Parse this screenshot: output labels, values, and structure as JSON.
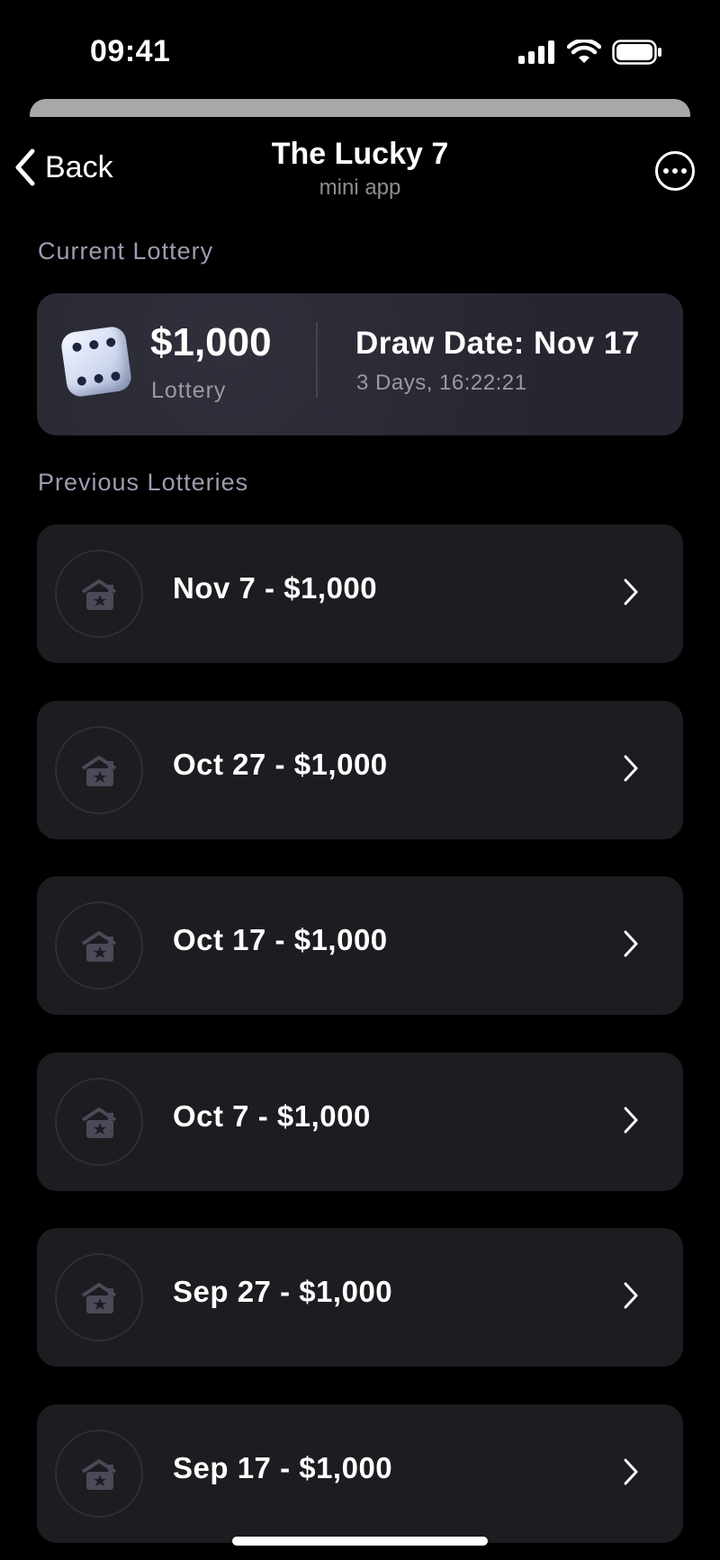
{
  "status_bar": {
    "time": "09:41"
  },
  "nav": {
    "back_label": "Back",
    "title": "The Lucky 7",
    "subtitle": "mini app"
  },
  "current": {
    "section_label": "Current Lottery",
    "amount": "$1,000",
    "amount_label": "Lottery",
    "draw_date": "Draw Date: Nov 17",
    "countdown": "3 Days, 16:22:21"
  },
  "previous": {
    "section_label": "Previous Lotteries",
    "items": [
      {
        "label": "Nov 7 - $1,000",
        "icon": "ticket-star-icon"
      },
      {
        "label": "Oct 27 - $1,000",
        "icon": "ticket-star-icon"
      },
      {
        "label": "Oct 17 - $1,000",
        "icon": "ticket-star-icon"
      },
      {
        "label": "Oct 7 - $1,000",
        "icon": "ticket-star-icon"
      },
      {
        "label": "Sep 27 - $1,000",
        "icon": "ticket-star-icon"
      },
      {
        "label": "Sep 17 - $1,000",
        "icon": "ticket-star-icon"
      }
    ]
  },
  "colors": {
    "background": "#000000",
    "card": "#1c1c21",
    "current_card": "#2a2a35",
    "muted_text": "#9c9cb0"
  }
}
